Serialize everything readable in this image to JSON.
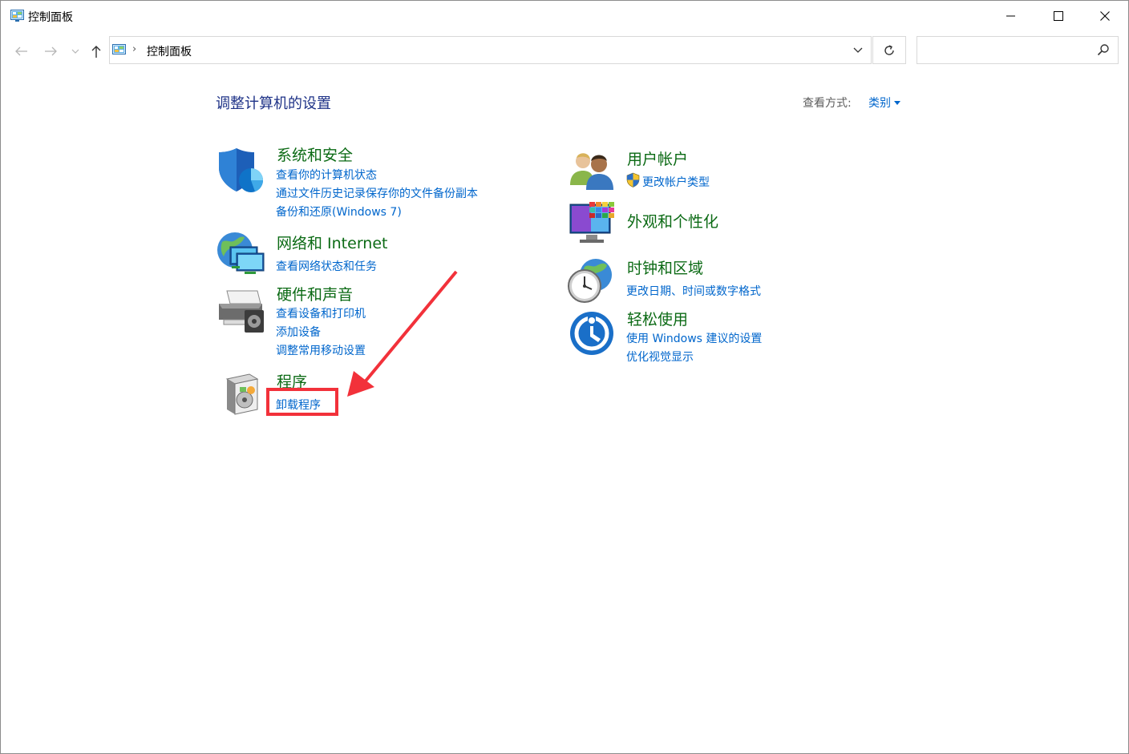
{
  "window": {
    "title": "控制面板",
    "controls": {
      "minimize": "minimize",
      "maximize": "maximize",
      "close": "close"
    }
  },
  "nav": {
    "breadcrumb_sep": "›",
    "address": "控制面板",
    "search_placeholder": ""
  },
  "content": {
    "page_title": "调整计算机的设置",
    "view_label": "查看方式:",
    "view_value": "类别"
  },
  "categories_left": [
    {
      "title": "系统和安全",
      "links": [
        "查看你的计算机状态",
        "通过文件历史记录保存你的文件备份副本",
        "备份和还原(Windows 7)"
      ]
    },
    {
      "title": "网络和 Internet",
      "links": [
        "查看网络状态和任务"
      ]
    },
    {
      "title": "硬件和声音",
      "links": [
        "查看设备和打印机",
        "添加设备",
        "调整常用移动设置"
      ]
    },
    {
      "title": "程序",
      "links": [
        "卸载程序"
      ]
    }
  ],
  "categories_right": [
    {
      "title": "用户帐户",
      "links": [
        "更改帐户类型"
      ]
    },
    {
      "title": "外观和个性化",
      "links": []
    },
    {
      "title": "时钟和区域",
      "links": [
        "更改日期、时间或数字格式"
      ]
    },
    {
      "title": "轻松使用",
      "links": [
        "使用 Windows 建议的设置",
        "优化视觉显示"
      ]
    }
  ],
  "colors": {
    "category_title": "#0b6a14",
    "link": "#0066cc",
    "page_title": "#1e3287",
    "annotation": "#f2313a"
  },
  "icons": {
    "system_security": "shield-icon",
    "network": "network-globe-icon",
    "hardware": "printer-icon",
    "programs": "programs-box-icon",
    "user_accounts": "users-icon",
    "appearance": "monitor-color-icon",
    "clock_region": "clock-globe-icon",
    "ease_of_access": "ease-of-access-icon",
    "uac": "uac-shield-icon"
  }
}
